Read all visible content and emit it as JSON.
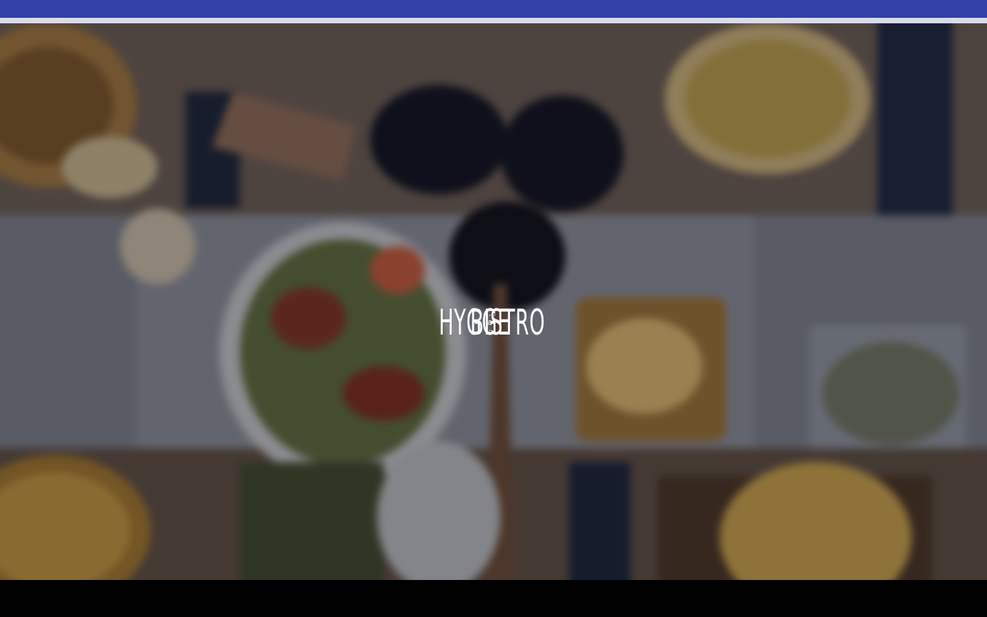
{
  "colors": {
    "top_bar": "#3240a8",
    "bottom_bar": "#000000",
    "brand_text": "#ffffff"
  },
  "hero": {
    "image_icon": "food-table-photo",
    "brand": {
      "left_word": "HYGGE",
      "middle_line_1": "···",
      "middle_line_2": "&",
      "middle_line_3": "···",
      "right_word": "BISTRO"
    }
  }
}
